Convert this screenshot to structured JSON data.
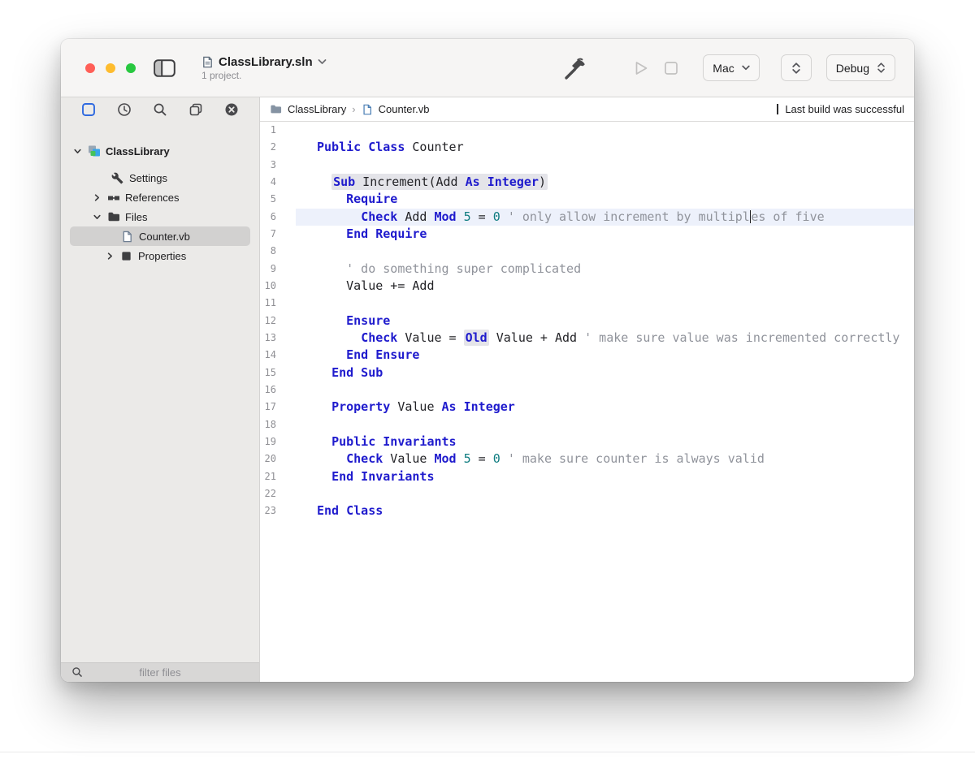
{
  "window": {
    "title": "ClassLibrary.sln",
    "subtitle": "1 project.",
    "device": "Mac",
    "configuration": "Debug"
  },
  "breadcrumb": {
    "project": "ClassLibrary",
    "file": "Counter.vb"
  },
  "status": {
    "message": "Last build was successful"
  },
  "sidebar": {
    "filter_placeholder": "filter files",
    "tree": {
      "root": "ClassLibrary",
      "items": [
        {
          "label": "Settings"
        },
        {
          "label": "References"
        },
        {
          "label": "Files"
        },
        {
          "label": "Counter.vb",
          "selected": true
        },
        {
          "label": "Properties"
        }
      ]
    }
  },
  "colors": {
    "keyword": "#1f1bcd",
    "number": "#0e7c80",
    "comment": "#90939b",
    "current_line": "#edf1fb",
    "selection_highlight": "#e4e4e9",
    "traffic_red": "#ff5f57",
    "traffic_yellow": "#febc2e",
    "traffic_green": "#28c840"
  },
  "editor": {
    "language": "VB",
    "lines": [
      {
        "n": 1,
        "tokens": []
      },
      {
        "n": 2,
        "tokens": [
          {
            "t": "Public Class",
            "c": "kw"
          },
          {
            "t": " Counter",
            "c": "id"
          }
        ]
      },
      {
        "n": 3,
        "tokens": []
      },
      {
        "n": 4,
        "tokens": [
          {
            "t": "  ",
            "c": "id"
          },
          {
            "t": "Sub",
            "c": "kw",
            "bg": 1
          },
          {
            "t": " Increment(Add ",
            "c": "id",
            "bg": 1
          },
          {
            "t": "As Integer",
            "c": "kw",
            "bg": 1
          },
          {
            "t": ")",
            "c": "id",
            "bg": 1
          }
        ]
      },
      {
        "n": 5,
        "tokens": [
          {
            "t": "    ",
            "c": "id"
          },
          {
            "t": "Require",
            "c": "kw"
          }
        ]
      },
      {
        "n": 6,
        "current": true,
        "tokens": [
          {
            "t": "      ",
            "c": "id"
          },
          {
            "t": "Check",
            "c": "kw"
          },
          {
            "t": " Add ",
            "c": "id"
          },
          {
            "t": "Mod",
            "c": "kw"
          },
          {
            "t": " ",
            "c": "id"
          },
          {
            "t": "5",
            "c": "num"
          },
          {
            "t": " = ",
            "c": "id"
          },
          {
            "t": "0",
            "c": "num"
          },
          {
            "t": " ",
            "c": "id"
          },
          {
            "t": "' only allow increment by multipl",
            "c": "com"
          },
          {
            "caret": true
          },
          {
            "t": "es of five",
            "c": "com"
          }
        ]
      },
      {
        "n": 7,
        "tokens": [
          {
            "t": "    ",
            "c": "id"
          },
          {
            "t": "End Require",
            "c": "kw"
          }
        ]
      },
      {
        "n": 8,
        "tokens": []
      },
      {
        "n": 9,
        "tokens": [
          {
            "t": "    ",
            "c": "id"
          },
          {
            "t": "' do something super complicated",
            "c": "com"
          }
        ]
      },
      {
        "n": 10,
        "tokens": [
          {
            "t": "    Value += Add",
            "c": "id"
          }
        ]
      },
      {
        "n": 11,
        "tokens": []
      },
      {
        "n": 12,
        "tokens": [
          {
            "t": "    ",
            "c": "id"
          },
          {
            "t": "Ensure",
            "c": "kw"
          }
        ]
      },
      {
        "n": 13,
        "tokens": [
          {
            "t": "      ",
            "c": "id"
          },
          {
            "t": "Check",
            "c": "kw"
          },
          {
            "t": " Value = ",
            "c": "id"
          },
          {
            "t": "Old",
            "c": "kw",
            "bg": 1
          },
          {
            "t": " Value + Add ",
            "c": "id"
          },
          {
            "t": "' make sure value was incremented correctly",
            "c": "com"
          }
        ]
      },
      {
        "n": 14,
        "tokens": [
          {
            "t": "    ",
            "c": "id"
          },
          {
            "t": "End Ensure",
            "c": "kw"
          }
        ]
      },
      {
        "n": 15,
        "tokens": [
          {
            "t": "  ",
            "c": "id"
          },
          {
            "t": "End Sub",
            "c": "kw"
          }
        ]
      },
      {
        "n": 16,
        "tokens": []
      },
      {
        "n": 17,
        "tokens": [
          {
            "t": "  ",
            "c": "id"
          },
          {
            "t": "Property",
            "c": "kw"
          },
          {
            "t": " Value ",
            "c": "id"
          },
          {
            "t": "As Integer",
            "c": "kw"
          }
        ]
      },
      {
        "n": 18,
        "tokens": []
      },
      {
        "n": 19,
        "tokens": [
          {
            "t": "  ",
            "c": "id"
          },
          {
            "t": "Public Invariants",
            "c": "kw"
          }
        ]
      },
      {
        "n": 20,
        "tokens": [
          {
            "t": "    ",
            "c": "id"
          },
          {
            "t": "Check",
            "c": "kw"
          },
          {
            "t": " Value ",
            "c": "id"
          },
          {
            "t": "Mod",
            "c": "kw"
          },
          {
            "t": " ",
            "c": "id"
          },
          {
            "t": "5",
            "c": "num"
          },
          {
            "t": " = ",
            "c": "id"
          },
          {
            "t": "0",
            "c": "num"
          },
          {
            "t": " ",
            "c": "id"
          },
          {
            "t": "' make sure counter is always valid",
            "c": "com"
          }
        ]
      },
      {
        "n": 21,
        "tokens": [
          {
            "t": "  ",
            "c": "id"
          },
          {
            "t": "End Invariants",
            "c": "kw"
          }
        ]
      },
      {
        "n": 22,
        "tokens": []
      },
      {
        "n": 23,
        "tokens": [
          {
            "t": "End Class",
            "c": "kw"
          }
        ]
      }
    ]
  }
}
